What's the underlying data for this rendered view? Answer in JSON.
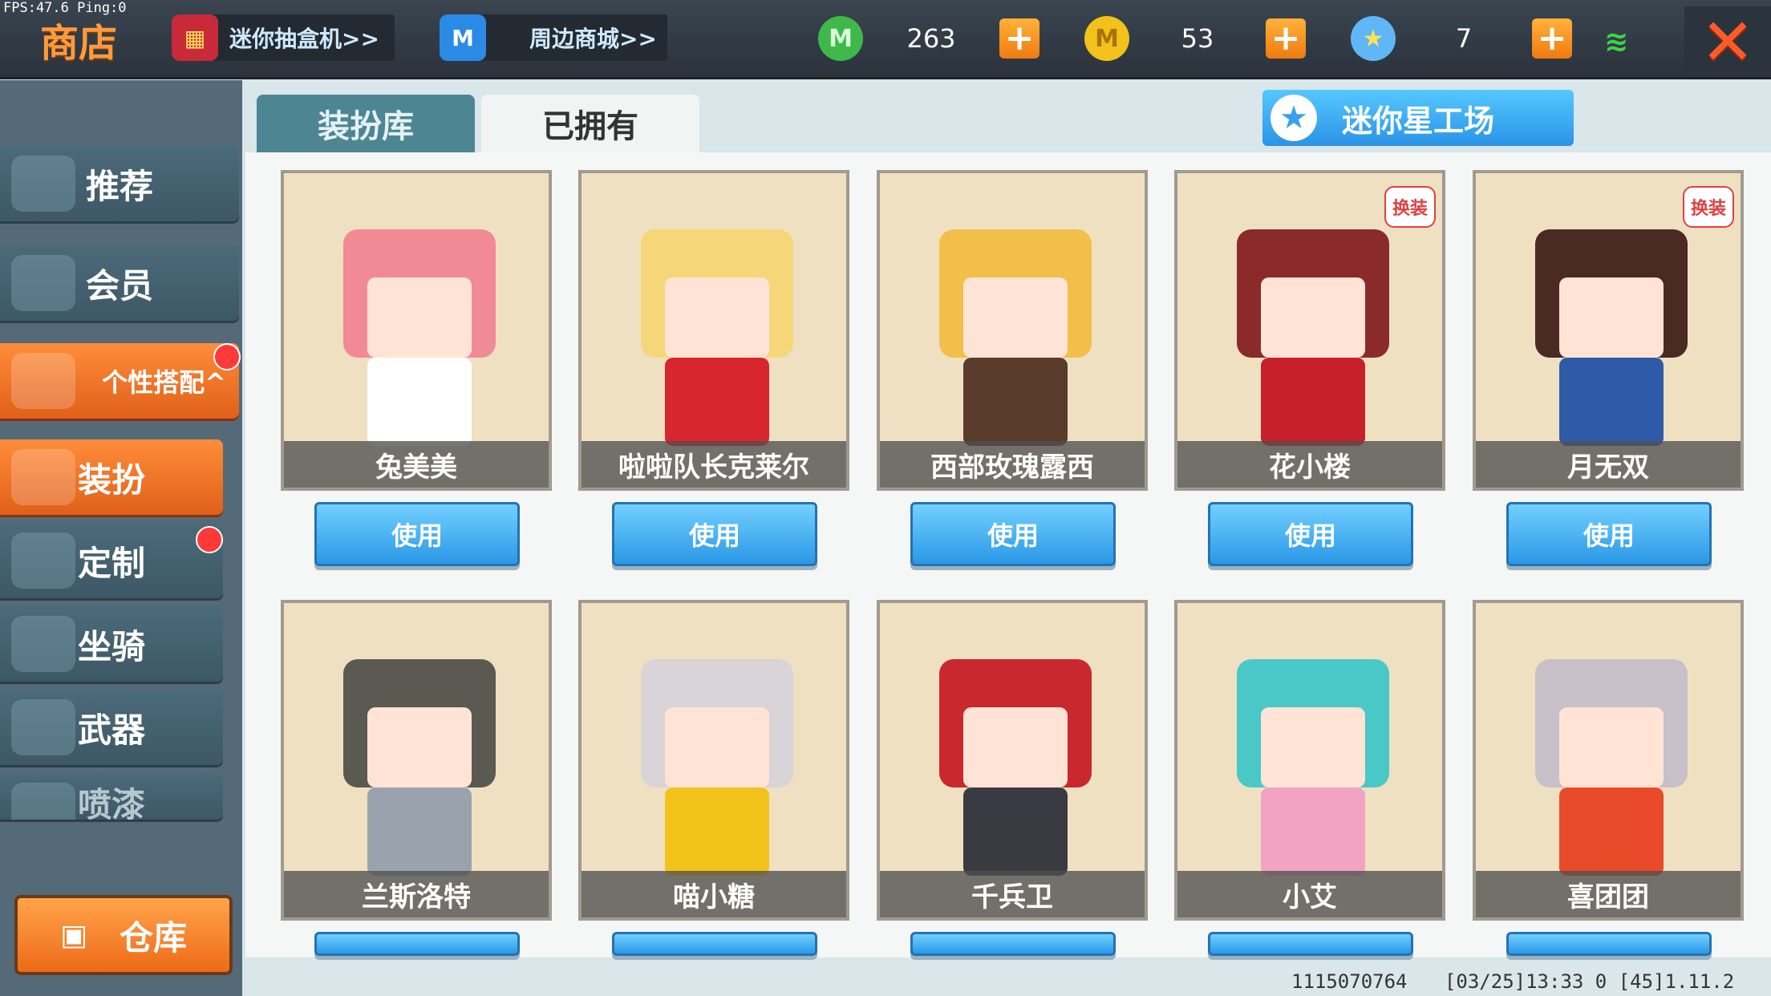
{
  "fps": "FPS:47.6  Ping:0",
  "header": {
    "title": "商店",
    "gacha_label": "迷你抽盒机>>",
    "mall_label": "周边商城>>",
    "currencies": [
      {
        "icon": "green-coin-icon",
        "symbol": "M",
        "value": "263",
        "color": "#3fb84a"
      },
      {
        "icon": "gold-coin-icon",
        "symbol": "M",
        "value": "53",
        "color": "#f2c21a"
      },
      {
        "icon": "star-coin-icon",
        "symbol": "★",
        "value": "7",
        "color": "#5fb7f5"
      }
    ]
  },
  "sidebar": {
    "items": [
      {
        "label": "推荐"
      },
      {
        "label": "会员"
      },
      {
        "label": "个性搭配^"
      },
      {
        "label": "装扮"
      },
      {
        "label": "定制"
      },
      {
        "label": "坐骑"
      },
      {
        "label": "武器"
      },
      {
        "label": "喷漆"
      }
    ],
    "storage_label": "仓库"
  },
  "tabs": [
    {
      "label": "装扮库"
    },
    {
      "label": "已拥有"
    }
  ],
  "workshop_label": "迷你星工场",
  "use_label": "使用",
  "badge_label": "换装",
  "skins": [
    {
      "name": "兔美美",
      "hair": "#f28a96",
      "outfit": "#ffffff"
    },
    {
      "name": "啦啦队长克莱尔",
      "hair": "#f5d77a",
      "outfit": "#d8262e"
    },
    {
      "name": "西部玫瑰露西",
      "hair": "#f2c04a",
      "outfit": "#5a3a2a"
    },
    {
      "name": "花小楼",
      "hair": "#8a2a2a",
      "outfit": "#c8202a"
    },
    {
      "name": "月无双",
      "hair": "#4a2a22",
      "outfit": "#2e5aa8"
    },
    {
      "name": "兰斯洛特",
      "hair": "#5a5a52",
      "outfit": "#9aa2ae"
    },
    {
      "name": "喵小糖",
      "hair": "#d8d4d8",
      "outfit": "#f2c21a"
    },
    {
      "name": "千兵卫",
      "hair": "#c8282e",
      "outfit": "#3a3a42"
    },
    {
      "name": "小艾",
      "hair": "#4ac8c8",
      "outfit": "#f2a2c2"
    },
    {
      "name": "喜团团",
      "hair": "#c8c0c8",
      "outfit": "#e84a2a"
    }
  ],
  "footer": {
    "uid": "1115070764",
    "info": "[03/25]13:33 0 [45]1.11.2"
  }
}
